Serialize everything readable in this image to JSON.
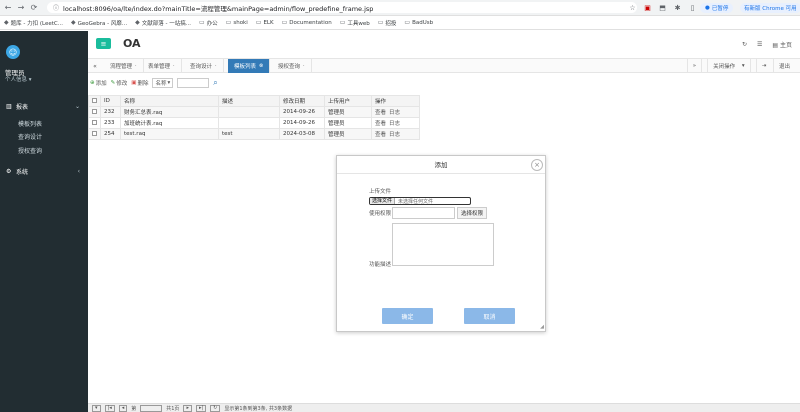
{
  "browser": {
    "url": "localhost:8096/oa/lte/index.do?mainTitle=流程管理&mainPage=admin/flow_predefine_frame.jsp",
    "profile_label": "已暂停",
    "chrome_label": "有新版 Chrome 可用",
    "bookmarks": [
      "题库 - 力扣 (LeetC...",
      "GeoGebra - 风靡...",
      "文献部落 - 一站搞...",
      "办公",
      "shoki",
      "ELK",
      "Documentation",
      "工具web",
      "招投",
      "BadUsb"
    ]
  },
  "sidebar": {
    "user_name": "管理员",
    "user_sub": "个人信息 ▾",
    "sections": [
      {
        "label": "报表",
        "items": [
          "模板列表",
          "查询设计",
          "授权查询"
        ]
      },
      {
        "label": "系统",
        "items": []
      }
    ]
  },
  "header": {
    "title": "OA",
    "right_home": "主页"
  },
  "tabs": {
    "items": [
      "流程管理",
      "表单管理",
      "查询设计",
      "模板列表",
      "授权查询"
    ],
    "active_index": 3,
    "close_ops": "关闭操作",
    "logout": "退出"
  },
  "toolbar": {
    "add": "添加",
    "edit": "修改",
    "delete": "删除",
    "field_select": "名称"
  },
  "table": {
    "headers": [
      "ID",
      "名称",
      "描述",
      "修改日期",
      "上传用户",
      "操作"
    ],
    "rows": [
      {
        "id": "232",
        "name": "财务汇总表.raq",
        "desc": "",
        "date": "2014-09-26",
        "user": "管理员",
        "op1": "查看",
        "op2": "日志"
      },
      {
        "id": "233",
        "name": "加班统计表.raq",
        "desc": "",
        "date": "2014-09-26",
        "user": "管理员",
        "op1": "查看",
        "op2": "日志"
      },
      {
        "id": "254",
        "name": "test.raq",
        "desc": "test",
        "date": "2024-03-08",
        "user": "管理员",
        "op1": "查看",
        "op2": "日志"
      }
    ]
  },
  "footer": {
    "page_label": "第",
    "page_total": "共1页",
    "summary": "显示第1条到第3条, 共3条数据"
  },
  "modal": {
    "title": "添加",
    "upload_label": "上传文件",
    "choose_file": "选择文件",
    "no_file": "未选择任何文件",
    "permission_label": "使用权限",
    "choose_permission": "选择权限",
    "description_label": "功能描述",
    "ok": "确定",
    "cancel": "取消"
  }
}
